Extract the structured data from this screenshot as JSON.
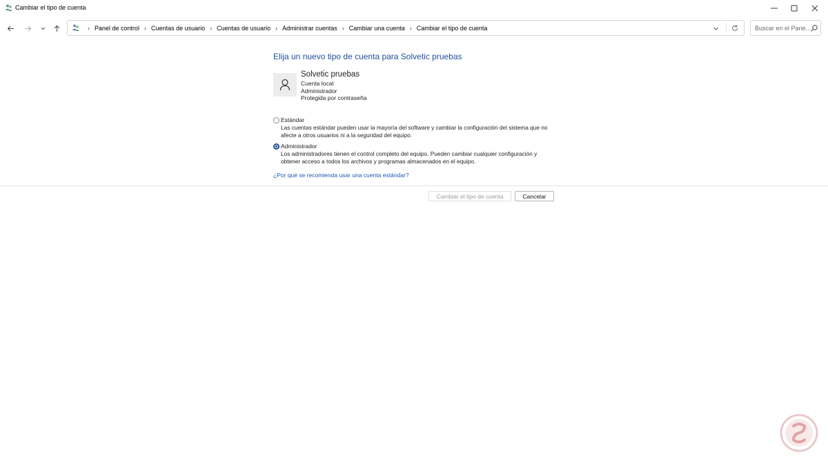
{
  "window": {
    "title": "Cambiar el tipo de cuenta",
    "icon": "users-control-panel-icon"
  },
  "nav": {
    "breadcrumbs": [
      "Panel de control",
      "Cuentas de usuario",
      "Cuentas de usuario",
      "Administrar cuentas",
      "Cambiar una cuenta",
      "Cambiar el tipo de cuenta"
    ],
    "search_placeholder": "Buscar en el Pane..."
  },
  "main": {
    "heading": "Elija un nuevo tipo de cuenta para Solvetic pruebas",
    "account": {
      "name": "Solvetic pruebas",
      "details": [
        "Cuenta local",
        "Administrador",
        "Protegida por contraseña"
      ]
    },
    "options": [
      {
        "label": "Estándar",
        "description": "Las cuentas estándar pueden usar la mayoría del software y cambiar la configuración del sistema que no afecte a otros usuarios ni a la seguridad del equipo.",
        "selected": false
      },
      {
        "label": "Administrador",
        "description": "Los administradores tienen el control completo del equipo. Pueden cambiar cualquier configuración y obtener acceso a todos los archivos y programas almacenados en el equipo.",
        "selected": true
      }
    ],
    "help_link": "¿Por qué se recomienda usar una cuenta estándar?",
    "buttons": {
      "change": "Cambiar el tipo de cuenta",
      "cancel": "Cancelar"
    }
  },
  "colors": {
    "heading": "#1e4e9e",
    "link": "#1a58b3",
    "radio_selected": "#1c4f96",
    "watermark": "#d6262c"
  }
}
